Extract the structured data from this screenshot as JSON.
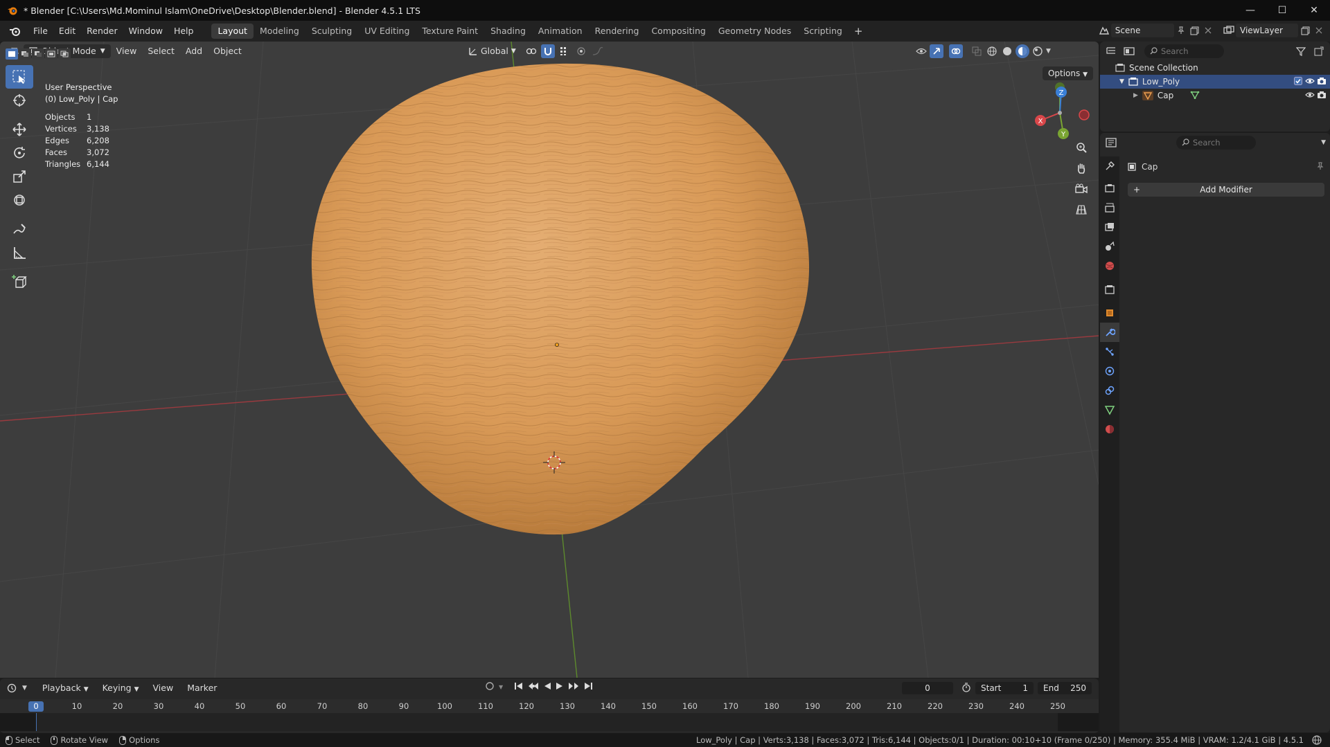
{
  "window": {
    "title": "* Blender [C:\\Users\\Md.Mominul Islam\\OneDrive\\Desktop\\Blender.blend] - Blender 4.5.1 LTS",
    "minimize": "—",
    "maximize": "☐",
    "close": "✕"
  },
  "menu": [
    "File",
    "Edit",
    "Render",
    "Window",
    "Help"
  ],
  "workspaces": [
    "Layout",
    "Modeling",
    "Sculpting",
    "UV Editing",
    "Texture Paint",
    "Shading",
    "Animation",
    "Rendering",
    "Compositing",
    "Geometry Nodes",
    "Scripting"
  ],
  "workspace_active": "Layout",
  "workspace_add": "+",
  "scene": {
    "label": "Scene"
  },
  "view_layer": {
    "label": "ViewLayer"
  },
  "viewport": {
    "mode": "Object Mode",
    "menus": [
      "View",
      "Select",
      "Add",
      "Object"
    ],
    "orientation": "Global",
    "options": "Options",
    "view_name": "User Perspective",
    "collection_info": "(0) Low_Poly | Cap",
    "stats": [
      {
        "label": "Objects",
        "value": "1"
      },
      {
        "label": "Vertices",
        "value": "3,138"
      },
      {
        "label": "Edges",
        "value": "6,208"
      },
      {
        "label": "Faces",
        "value": "3,072"
      },
      {
        "label": "Triangles",
        "value": "6,144"
      }
    ],
    "gizmo": {
      "x": "X",
      "y": "Y",
      "z": "Z"
    }
  },
  "outliner": {
    "search_placeholder": "Search",
    "root": "Scene Collection",
    "collection": "Low_Poly",
    "object": "Cap"
  },
  "properties": {
    "search_placeholder": "Search",
    "object_name": "Cap",
    "add_modifier": "Add Modifier",
    "add_icon": "+"
  },
  "timeline": {
    "menus": [
      "Playback",
      "Keying",
      "View",
      "Marker"
    ],
    "current_frame": "0",
    "start_label": "Start",
    "start_value": "1",
    "end_label": "End",
    "end_value": "250",
    "ruler_current": "0",
    "ruler": [
      "10",
      "20",
      "30",
      "40",
      "50",
      "60",
      "70",
      "80",
      "90",
      "100",
      "110",
      "120",
      "130",
      "140",
      "150",
      "160",
      "170",
      "180",
      "190",
      "200",
      "210",
      "220",
      "230",
      "240",
      "250"
    ]
  },
  "status": {
    "select": "Select",
    "rotate": "Rotate View",
    "options": "Options",
    "info": "Low_Poly | Cap | Verts:3,138 | Faces:3,072 | Tris:6,144 | Objects:0/1 | Duration: 00:10+10 (Frame 0/250) | Memory: 355.4 MiB | VRAM: 1.2/4.1 GiB | 4.5.1"
  },
  "colors": {
    "accent": "#4772b3",
    "x_axis": "#d9474a",
    "y_axis": "#7aa532",
    "z_axis": "#3a7fd6",
    "object": "#d99a57"
  }
}
